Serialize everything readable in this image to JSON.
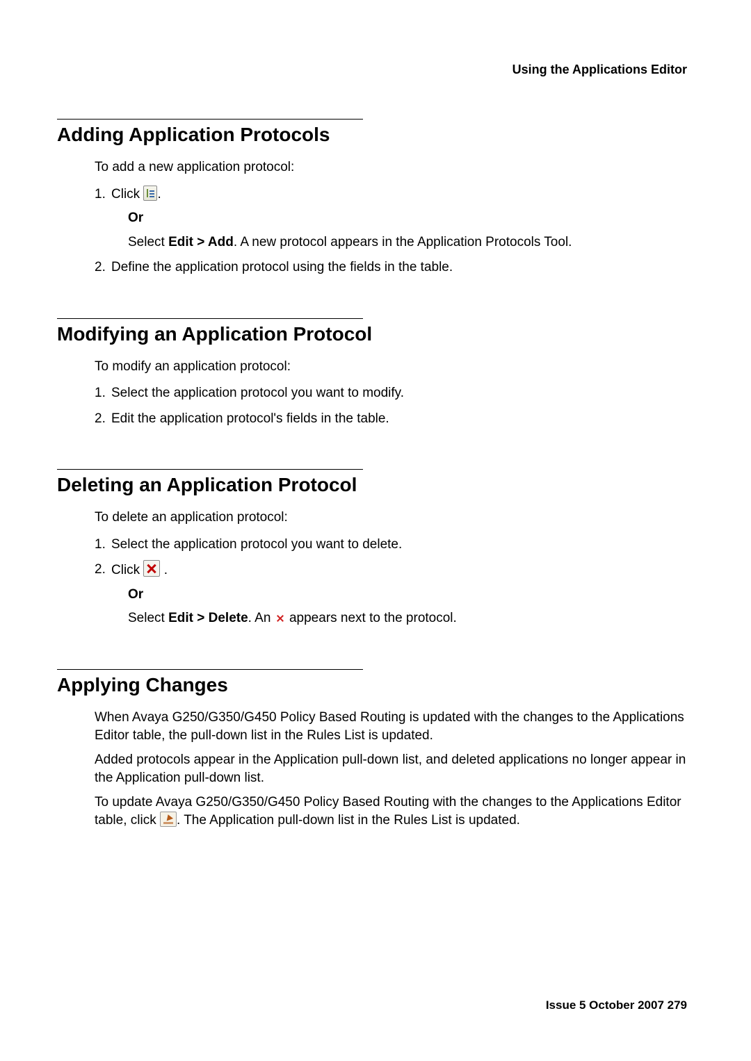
{
  "header": {
    "right": "Using the Applications Editor"
  },
  "s1": {
    "heading": "Adding Application Protocols",
    "lead": "To add a new application protocol:",
    "step1_a": "Click ",
    "step1_b": ".",
    "or": "Or",
    "step1_sub_a": "Select ",
    "step1_sub_menu": "Edit > Add",
    "step1_sub_b": ". A new protocol appears in the Application Protocols Tool.",
    "step2": "Define the application protocol using the fields in the table."
  },
  "s2": {
    "heading": "Modifying an Application Protocol",
    "lead": "To modify an application protocol:",
    "step1": "Select the application protocol you want to modify.",
    "step2": "Edit the application protocol's fields in the table."
  },
  "s3": {
    "heading": "Deleting an Application Protocol",
    "lead": "To delete an application protocol:",
    "step1": "Select the application protocol you want to delete.",
    "step2_a": "Click ",
    "step2_b": " .",
    "or": "Or",
    "step2_sub_a": "Select ",
    "step2_sub_menu": "Edit > Delete",
    "step2_sub_b": ". An ",
    "step2_sub_c": " appears next to the protocol."
  },
  "s4": {
    "heading": "Applying Changes",
    "p1": "When Avaya G250/G350/G450 Policy Based Routing is updated with the changes to the Applications Editor table, the pull-down list in the Rules List is updated.",
    "p2": "Added protocols appear in the Application pull-down list, and deleted applications no longer appear in the Application pull-down list.",
    "p3_a": "To update Avaya G250/G350/G450 Policy Based Routing with the changes to the Applications Editor table, click ",
    "p3_b": ". The Application pull-down list in the Rules List is updated."
  },
  "footer": {
    "issue": "Issue 5   October 2007    279"
  }
}
